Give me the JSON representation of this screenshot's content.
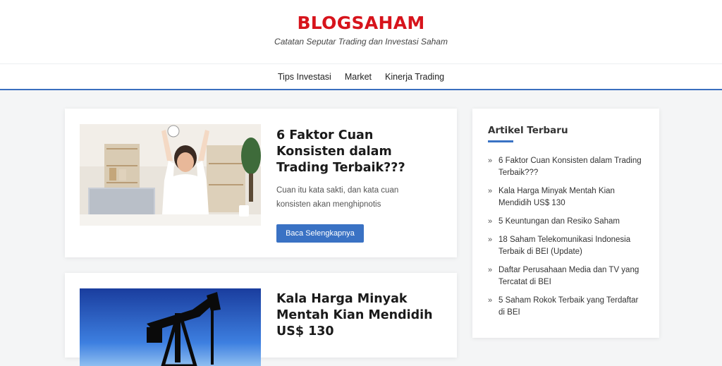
{
  "site": {
    "title": "BLOGSAHAM",
    "tagline": "Catatan Seputar Trading dan Investasi Saham",
    "accent_color": "#d7141c",
    "link_color": "#3a72c4"
  },
  "nav": {
    "items": [
      "Tips Investasi",
      "Market",
      "Kinerja Trading"
    ]
  },
  "posts": [
    {
      "title": "6 Faktor Cuan Konsisten dalam Trading Terbaik???",
      "excerpt": "Cuan itu kata sakti, dan kata cuan konsisten akan menghipnotis",
      "button": "Baca Selengkapnya",
      "thumbnail_icon": "celebrating-person-photo"
    },
    {
      "title": "Kala Harga Minyak Mentah Kian Mendidih US$ 130",
      "thumbnail_icon": "oil-pump-silhouette-photo"
    }
  ],
  "sidebar": {
    "title": "Artikel Terbaru",
    "items": [
      "6 Faktor Cuan Konsisten dalam Trading Terbaik???",
      "Kala Harga Minyak Mentah Kian Mendidih US$ 130",
      "5 Keuntungan dan Resiko Saham",
      "18 Saham Telekomunikasi Indonesia Terbaik di BEI (Update)",
      "Daftar Perusahaan Media dan TV yang Tercatat di BEI",
      "5 Saham Rokok Terbaik yang Terdaftar di BEI"
    ],
    "chevron": "»"
  }
}
